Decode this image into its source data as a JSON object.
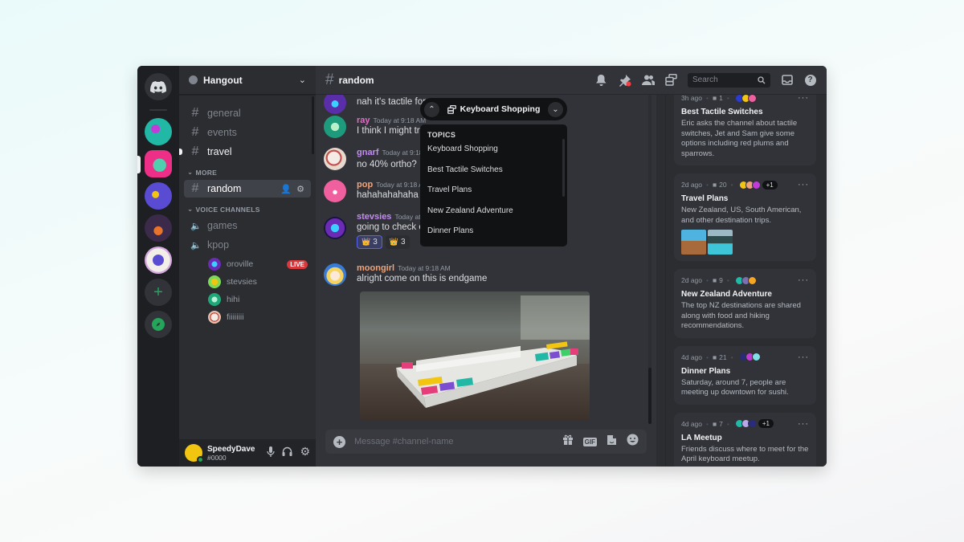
{
  "servers": [
    {
      "name": "home",
      "icon": "discord-logo-icon"
    },
    {
      "name": "server-1",
      "color": "#22b8a6"
    },
    {
      "name": "server-2",
      "color": "#ee2f87",
      "selected": true
    },
    {
      "name": "server-3",
      "color": "#5a4bd3"
    },
    {
      "name": "server-4",
      "color": "#6b3a2a"
    },
    {
      "name": "server-5",
      "color": "#d6a8e0"
    }
  ],
  "rail_actions": {
    "add": "+",
    "explore": "compass-icon"
  },
  "guild": {
    "name": "Hangout"
  },
  "channels": [
    {
      "name": "general",
      "state": "muted"
    },
    {
      "name": "events",
      "state": "muted"
    },
    {
      "name": "travel",
      "state": "unread"
    }
  ],
  "categories": {
    "more": "MORE",
    "voice": "VOICE CHANNELS"
  },
  "more_channels": [
    {
      "name": "random",
      "selected": true
    }
  ],
  "voice_channels": [
    {
      "name": "games"
    },
    {
      "name": "kpop",
      "users": [
        {
          "name": "oroville",
          "live": "LIVE",
          "color": "#6a2bb5"
        },
        {
          "name": "stevsies",
          "color": "#7ed957"
        },
        {
          "name": "hihi",
          "color": "#1fa97a"
        },
        {
          "name": "fiiiiiiii",
          "color": "#e9c2b4"
        }
      ]
    }
  ],
  "user": {
    "name": "SpeedyDave",
    "tag": "#0000"
  },
  "chat": {
    "channel": "random",
    "messages": [
      {
        "author": "",
        "time": "",
        "text": "nah it's tactile for",
        "color": "#c38bf2",
        "avatar": "#5a2ea8"
      },
      {
        "author": "ray",
        "time": "Today at 9:18 AM",
        "text": "I think I might try",
        "color": "#e06ec6",
        "avatar": "#1e9b7d"
      },
      {
        "author": "gnarf",
        "time": "Today at 9:18 AM",
        "text": "no 40% ortho? 😐",
        "color": "#c38bf2",
        "avatar": "#e8d9cf"
      },
      {
        "author": "pop",
        "time": "Today at 9:18 AM",
        "text": "hahahahahaha",
        "color": "#f0a37a",
        "avatar": "#f0609e"
      },
      {
        "author": "stevsies",
        "time": "Today at 9:18 AM",
        "text": "going to check out",
        "color": "#c38bf2",
        "avatar": "#6a2bb5",
        "reactions": [
          {
            "emoji": "👑",
            "count": "3",
            "mine": true
          },
          {
            "emoji": "👑",
            "count": "3",
            "mine": false
          }
        ]
      },
      {
        "author": "moongirl",
        "time": "Today at 9:18 AM",
        "text": "alright come on this is endgame",
        "color": "#f0a37a",
        "avatar": "#f4d35e",
        "image": "keyboard-photo"
      }
    ],
    "composer_placeholder": "Message #channel-name"
  },
  "topic_popover": {
    "current": "Keyboard Shopping",
    "header": "TOPICS",
    "items": [
      "Keyboard Shopping",
      "Best Tactile Switches",
      "Travel Plans",
      "New Zealand Adventure",
      "Dinner Plans"
    ]
  },
  "toolbar": {
    "search_placeholder": "Search"
  },
  "threads": [
    {
      "age": "3h ago",
      "count": "1",
      "title": "Best Tactile Switches",
      "desc": "Eric asks the channel about tactile switches, Jet and Sam give some options including red plums and sparrows.",
      "avatars": [
        "#2a3bd3",
        "#f2c511",
        "#f0609e"
      ]
    },
    {
      "age": "2d ago",
      "count": "20",
      "title": "Travel Plans",
      "desc": "New Zealand, US,  South American, and other destination trips.",
      "avatars": [
        "#f2c511",
        "#f0a37a",
        "#c13bd8"
      ],
      "more": "+1",
      "thumbs": true
    },
    {
      "age": "2d ago",
      "count": "9",
      "title": "New Zealand Adventure",
      "desc": "The top NZ destinations are shared along with food and hiking recommendations.",
      "avatars": [
        "#22b8a6",
        "#7b6fb5",
        "#f5a623"
      ]
    },
    {
      "age": "4d ago",
      "count": "21",
      "title": "Dinner Plans",
      "desc": "Saturday, around 7, people are meeting up downtown for sushi.",
      "avatars": [
        "#2a2b7a",
        "#c13bd8",
        "#7fe0e8"
      ]
    },
    {
      "age": "4d ago",
      "count": "7",
      "title": "LA Meetup",
      "desc": "Friends discuss where to meet for the April keyboard meetup.",
      "avatars": [
        "#22b8a6",
        "#b8a8e8",
        "#2a2b7a"
      ],
      "more": "+1"
    }
  ]
}
